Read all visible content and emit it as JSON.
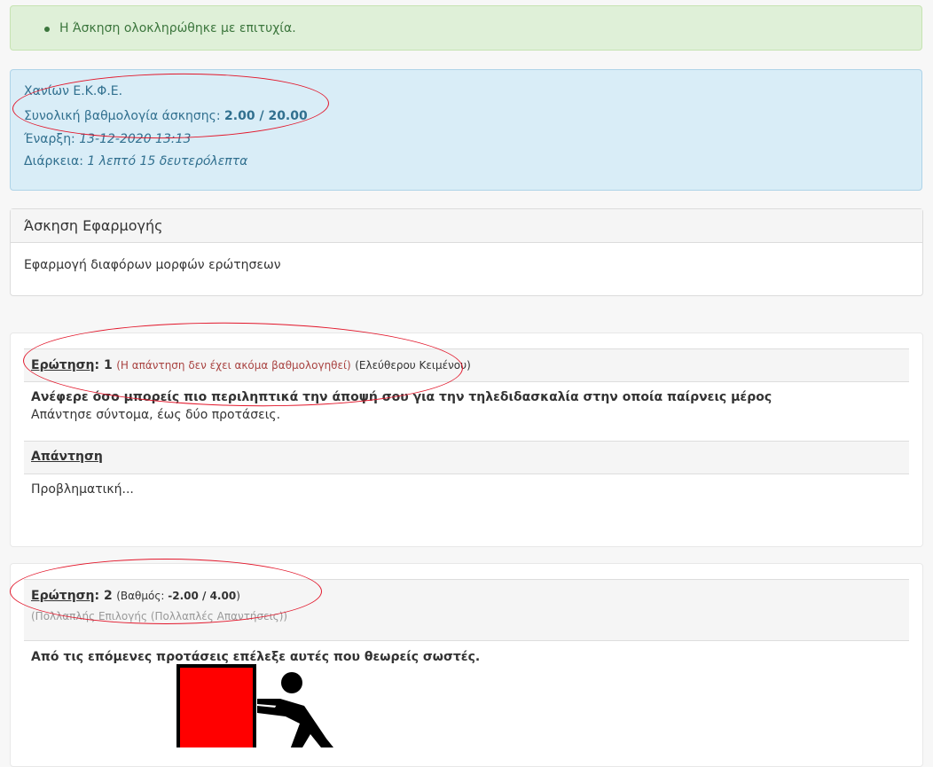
{
  "success_alert": {
    "message": "Η Άσκηση ολοκληρώθηκε με επιτυχία."
  },
  "result_info": {
    "school": "Χανίων Ε.Κ.Φ.Ε.",
    "total_label": "Συνολική βαθμολογία άσκησης: ",
    "total_value": "2.00 / 20.00",
    "start_label": "Έναρξη: ",
    "start_value": "13-12-2020 13:13",
    "duration_label": "Διάρκεια: ",
    "duration_value": "1 λεπτό 15 δευτερόλεπτα"
  },
  "exercise": {
    "title": "Άσκηση Εφαρμογής",
    "description": "Εφαρμογή διαφόρων μορφών ερώτησεων"
  },
  "questions": [
    {
      "label": "Ερώτηση",
      "number": ": 1",
      "status": "(Η απάντηση δεν έχει ακόμα βαθμολογηθεί)",
      "type": "(Ελεύθερου Κειμένου)",
      "text": "Ανέφερε όσο μπορείς πιο περιληπτικά την άποψή σου για την τηλεδιδασκαλία στην οποία παίρνεις μέρος",
      "subtext": "Απάντησε σύντομα, έως δύο προτάσεις.",
      "answer_label": "Απάντηση",
      "answer_text": "Προβληματική..."
    },
    {
      "label": "Ερώτηση",
      "number": ": 2",
      "score_prefix": "(Βαθμός: ",
      "score_value": "-2.00 / 4.00",
      "score_suffix": ")",
      "type": "(Πολλαπλής Επιλογής (Πολλαπλές Απαντήσεις))",
      "text": "Από τις επόμενες προτάσεις επέλεξε αυτές που θεωρείς σωστές."
    }
  ],
  "colors": {
    "annotation": "#e2172b",
    "picto_box": "#ff0000"
  }
}
